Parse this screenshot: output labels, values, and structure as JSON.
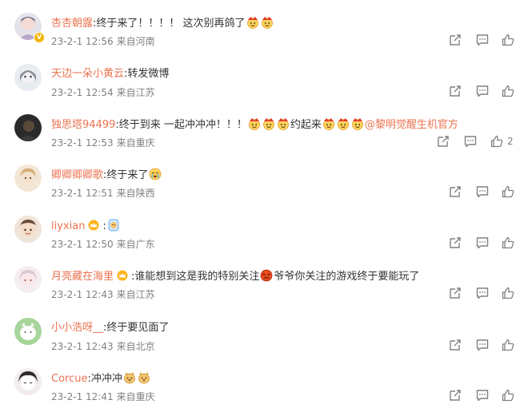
{
  "comments": [
    {
      "user": "杏杏朝露",
      "text": ":终于来了！！！！ 这次别再鸽了",
      "time": "23-2-1 12:56",
      "source": "来自河南",
      "likes": ""
    },
    {
      "user": "天边一朵小黄云",
      "text": ":转发微博",
      "time": "23-2-1 12:54",
      "source": "来自江苏",
      "likes": ""
    },
    {
      "user": "独思塔94499",
      "text": ":终于到来 一起冲冲冲！！！",
      "text2": "约起来",
      "mention": "@黎明觉醒生机官方",
      "time": "23-2-1 12:53",
      "source": "来自重庆",
      "likes": "2"
    },
    {
      "user": "卿卿卿卿歌",
      "text": ":终于来了",
      "time": "23-2-1 12:51",
      "source": "来自陕西",
      "likes": ""
    },
    {
      "user": "liyxian",
      "text": ":",
      "time": "23-2-1 12:50",
      "source": "来自广东",
      "likes": ""
    },
    {
      "user": "月亮藏在海里",
      "text": ":谁能想到这是我的特别关注",
      "text2": "爷爷你关注的游戏终于要能玩了",
      "time": "23-2-1 12:43",
      "source": "来自江苏",
      "likes": ""
    },
    {
      "user": "小小浩呀__",
      "text": ":终于要见面了",
      "time": "23-2-1 12:43",
      "source": "来自北京",
      "likes": ""
    },
    {
      "user": "Corcue",
      "text": ":冲冲冲",
      "time": "23-2-1 12:41",
      "source": "来自重庆",
      "likes": ""
    }
  ],
  "icons": {
    "repost": "repost-icon",
    "comment": "comment-icon",
    "like": "like-icon"
  },
  "colors": {
    "username": "#eb7350",
    "meta": "#808080",
    "text": "#333333"
  }
}
